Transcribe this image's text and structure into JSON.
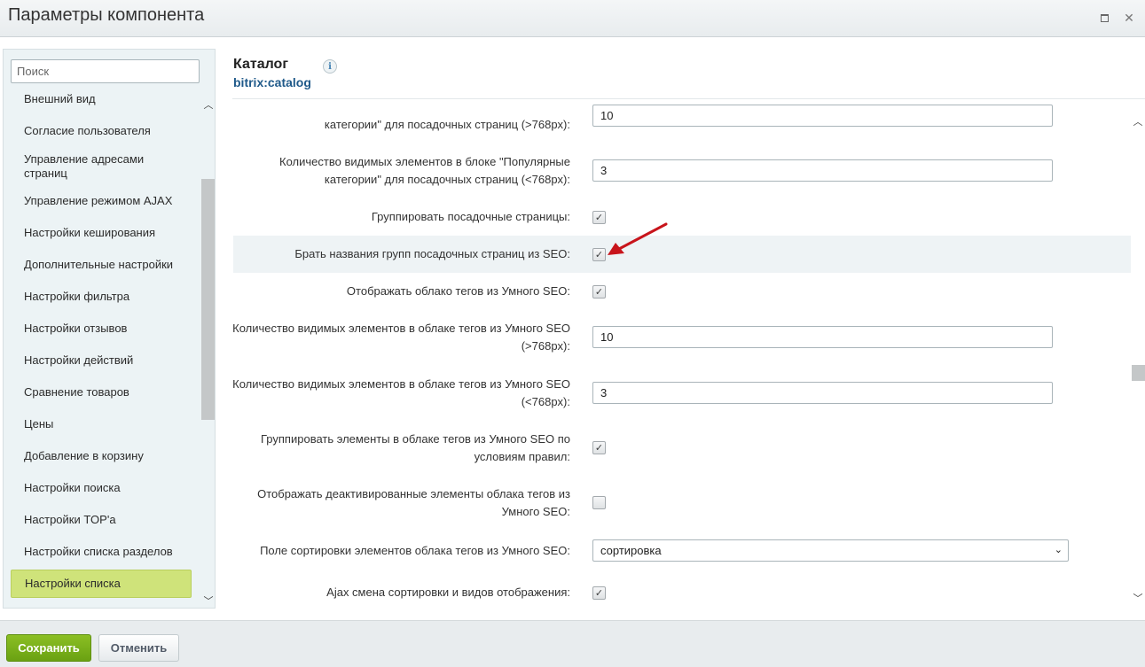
{
  "window": {
    "title": "Параметры компонента"
  },
  "sidebar": {
    "search_placeholder": "Поиск",
    "items": [
      {
        "label": "Внешний вид"
      },
      {
        "label": "Согласие пользователя"
      },
      {
        "label": "Управление адресами страниц"
      },
      {
        "label": "Управление режимом AJAX"
      },
      {
        "label": "Настройки кеширования"
      },
      {
        "label": "Дополнительные настройки"
      },
      {
        "label": "Настройки фильтра"
      },
      {
        "label": "Настройки отзывов"
      },
      {
        "label": "Настройки действий"
      },
      {
        "label": "Сравнение товаров"
      },
      {
        "label": "Цены"
      },
      {
        "label": "Добавление в корзину"
      },
      {
        "label": "Настройки поиска"
      },
      {
        "label": "Настройки TOP'а"
      },
      {
        "label": "Настройки списка разделов"
      },
      {
        "label": "Настройки списка",
        "active": true
      }
    ]
  },
  "component": {
    "title": "Каталог",
    "code": "bitrix:catalog"
  },
  "form": {
    "rows": [
      {
        "label": "категории\" для посадочных страниц (>768px):",
        "type": "text",
        "value": "10"
      },
      {
        "label": "Количество видимых элементов в блоке \"Популярные категории\" для посадочных страниц (<768px):",
        "type": "text",
        "value": "3"
      },
      {
        "label": "Группировать посадочные страницы:",
        "type": "checkbox",
        "checked": true
      },
      {
        "label": "Брать названия групп посадочных страниц из SEO:",
        "type": "checkbox",
        "checked": true,
        "highlighted": true
      },
      {
        "label": "Отображать облако тегов из Умного SEO:",
        "type": "checkbox",
        "checked": true
      },
      {
        "label": "Количество видимых элементов в облаке тегов из Умного SEO (>768px):",
        "type": "text",
        "value": "10"
      },
      {
        "label": "Количество видимых элементов в облаке тегов из Умного SEO (<768px):",
        "type": "text",
        "value": "3"
      },
      {
        "label": "Группировать элементы в облаке тегов из Умного SEO по условиям правил:",
        "type": "checkbox",
        "checked": true
      },
      {
        "label": "Отображать деактивированные элементы облака тегов из Умного SEO:",
        "type": "checkbox",
        "checked": false
      },
      {
        "label": "Поле сортировки элементов облака тегов из Умного SEO:",
        "type": "select",
        "value": "сортировка"
      },
      {
        "label": "Ajax смена сортировки и видов отображения:",
        "type": "checkbox",
        "checked": true
      }
    ]
  },
  "footer": {
    "save_label": "Сохранить",
    "cancel_label": "Отменить"
  },
  "colors": {
    "accent_green": "#7ab51d",
    "active_item": "#cfe37a",
    "link_blue": "#205a8a",
    "annotation_arrow": "#c8141b"
  }
}
